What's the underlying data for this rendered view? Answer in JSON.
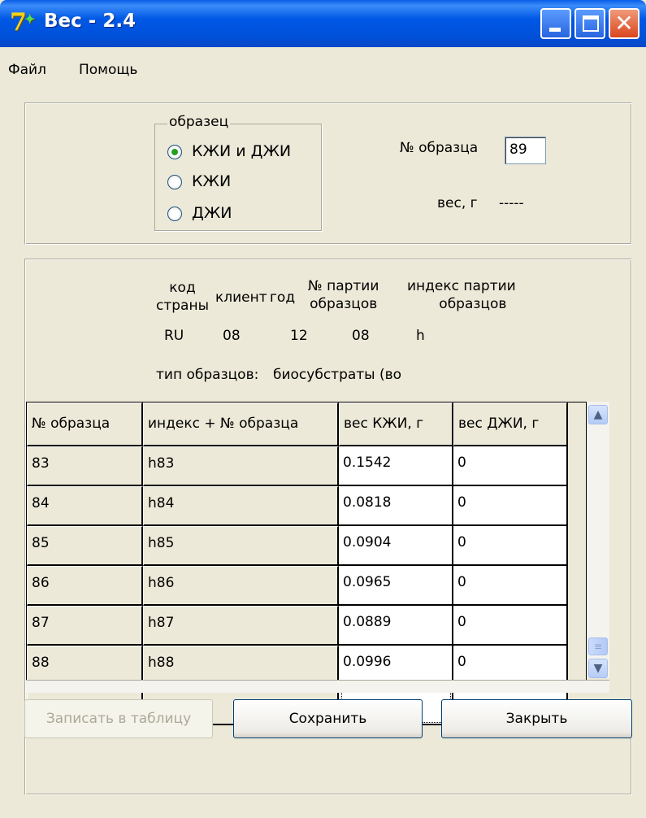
{
  "window": {
    "title": "Вес - 2.4"
  },
  "menu": {
    "items": [
      "Файл",
      "Помощь"
    ]
  },
  "sample_group": {
    "legend": "образец",
    "options": [
      "КЖИ и ДЖИ",
      "КЖИ",
      "ДЖИ"
    ],
    "selected_index": 0
  },
  "sample_number": {
    "label": "№ образца",
    "value": "89"
  },
  "weight": {
    "label": "вес, г",
    "value": "-----"
  },
  "batch_headers": {
    "country_code": [
      "код",
      "страны"
    ],
    "client": "клиент",
    "year": "год",
    "batch_no": [
      "№ партии",
      "образцов"
    ],
    "batch_index": [
      "индекс партии",
      "образцов"
    ]
  },
  "batch_values": {
    "country_code": "RU",
    "client": "08",
    "year": "12",
    "batch_no": "08",
    "batch_index": "h"
  },
  "sample_type": {
    "label": "тип образцов:",
    "value": "биосубстраты (во"
  },
  "table": {
    "columns": [
      "№ образца",
      "индекс + № образца",
      "вес КЖИ, г",
      "вес ДЖИ, г"
    ],
    "rows": [
      [
        "83",
        "h83",
        "0.1542",
        "0"
      ],
      [
        "84",
        "h84",
        "0.0818",
        "0"
      ],
      [
        "85",
        "h85",
        "0.0904",
        "0"
      ],
      [
        "86",
        "h86",
        "0.0965",
        "0"
      ],
      [
        "87",
        "h87",
        "0.0889",
        "0"
      ],
      [
        "88",
        "h88",
        "0.0996",
        "0"
      ],
      [
        "",
        "",
        "",
        ""
      ]
    ]
  },
  "buttons": {
    "write": "Записать в таблицу",
    "save": "Сохранить",
    "close": "Закрыть"
  }
}
